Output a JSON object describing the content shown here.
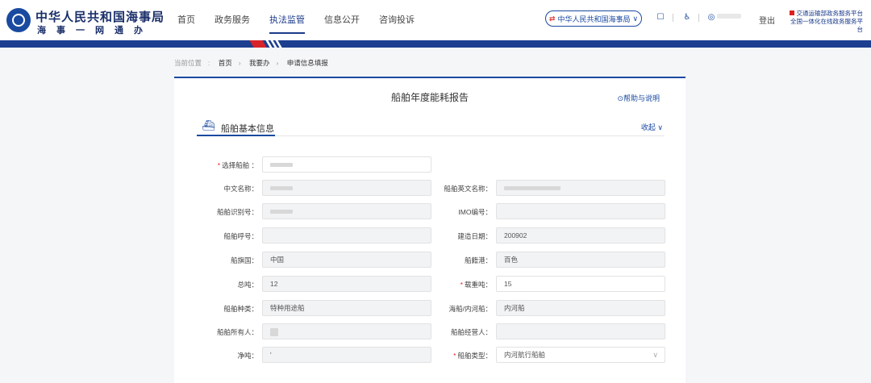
{
  "header": {
    "brand_title": "中华人民共和国海事局",
    "brand_sub": "海事一网通办",
    "nav": [
      "首页",
      "政务服务",
      "执法监管",
      "信息公开",
      "咨询投诉"
    ],
    "active_nav": "执法监管",
    "region": "中华人民共和国海事局",
    "logout": "登出",
    "promo_line1": "交通运输部政务服务平台",
    "promo_line2": "全国一体化在线政务服务平台"
  },
  "breadcrumb": {
    "label": "当前位置",
    "items": [
      "首页",
      "我要办",
      "申请信息填报"
    ]
  },
  "form": {
    "title": "船舶年度能耗报告",
    "help": "帮助与说明",
    "section_title": "船舶基本信息",
    "collapse": "收起",
    "select_ship_label": "选择船舶",
    "fields": [
      {
        "label": "中文名称",
        "value": "",
        "required": false
      },
      {
        "label": "船舶英文名称",
        "value": "",
        "required": false
      },
      {
        "label": "船舶识别号",
        "value": "",
        "required": false
      },
      {
        "label": "IMO编号",
        "value": "",
        "required": false
      },
      {
        "label": "船舶呼号",
        "value": "",
        "required": false
      },
      {
        "label": "建造日期",
        "value": "200902",
        "required": false
      },
      {
        "label": "船旗国",
        "value": "中国",
        "required": false
      },
      {
        "label": "船籍港",
        "value": "百色",
        "required": false
      },
      {
        "label": "总吨",
        "value": "12",
        "required": false
      },
      {
        "label": "载重吨",
        "value": "15",
        "required": true
      },
      {
        "label": "船舶种类",
        "value": "特种用途船",
        "required": false
      },
      {
        "label": "海船/内河船",
        "value": "内河船",
        "required": false
      },
      {
        "label": "船舶所有人",
        "value": "",
        "required": false
      },
      {
        "label": "船舶经营人",
        "value": "",
        "required": false
      },
      {
        "label": "净吨",
        "value": "'",
        "required": false
      },
      {
        "label": "船舶类型",
        "value": "内河航行船舶",
        "required": true
      }
    ]
  },
  "colors": {
    "primary": "#1a4aa0",
    "accent": "#d8232a"
  }
}
